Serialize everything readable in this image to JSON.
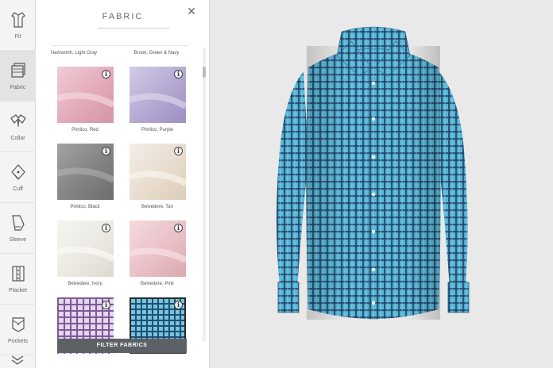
{
  "rail": {
    "items": [
      {
        "label": "Fit",
        "icon": "shirt-fit-icon"
      },
      {
        "label": "Fabric",
        "icon": "fabric-icon",
        "active": true
      },
      {
        "label": "Collar",
        "icon": "collar-icon"
      },
      {
        "label": "Cuff",
        "icon": "cuff-icon"
      },
      {
        "label": "Sleeve",
        "icon": "sleeve-icon"
      },
      {
        "label": "Placket",
        "icon": "placket-icon"
      },
      {
        "label": "Pockets",
        "icon": "pockets-icon"
      }
    ]
  },
  "panel": {
    "title": "FABRIC",
    "partial_captions": [
      "Hamworth, Light Gray",
      "Brook, Green & Navy"
    ],
    "fabrics": [
      {
        "name": "Pimlico, Red",
        "color": "#e7b8c3"
      },
      {
        "name": "Pimlico, Purple",
        "color": "#bdb3d6"
      },
      {
        "name": "Pimlico, Black",
        "color": "#8e8e8e"
      },
      {
        "name": "Belvedere, Tan",
        "color": "#ece4d9"
      },
      {
        "name": "Belvedere, Ivory",
        "color": "#f0eee8"
      },
      {
        "name": "Belvedere, Pink",
        "color": "#ecc7cd"
      }
    ],
    "filter_label": "FILTER FABRICS"
  },
  "shirt": {
    "color": "#4aaecf",
    "check_color": "#1e3a5c"
  }
}
